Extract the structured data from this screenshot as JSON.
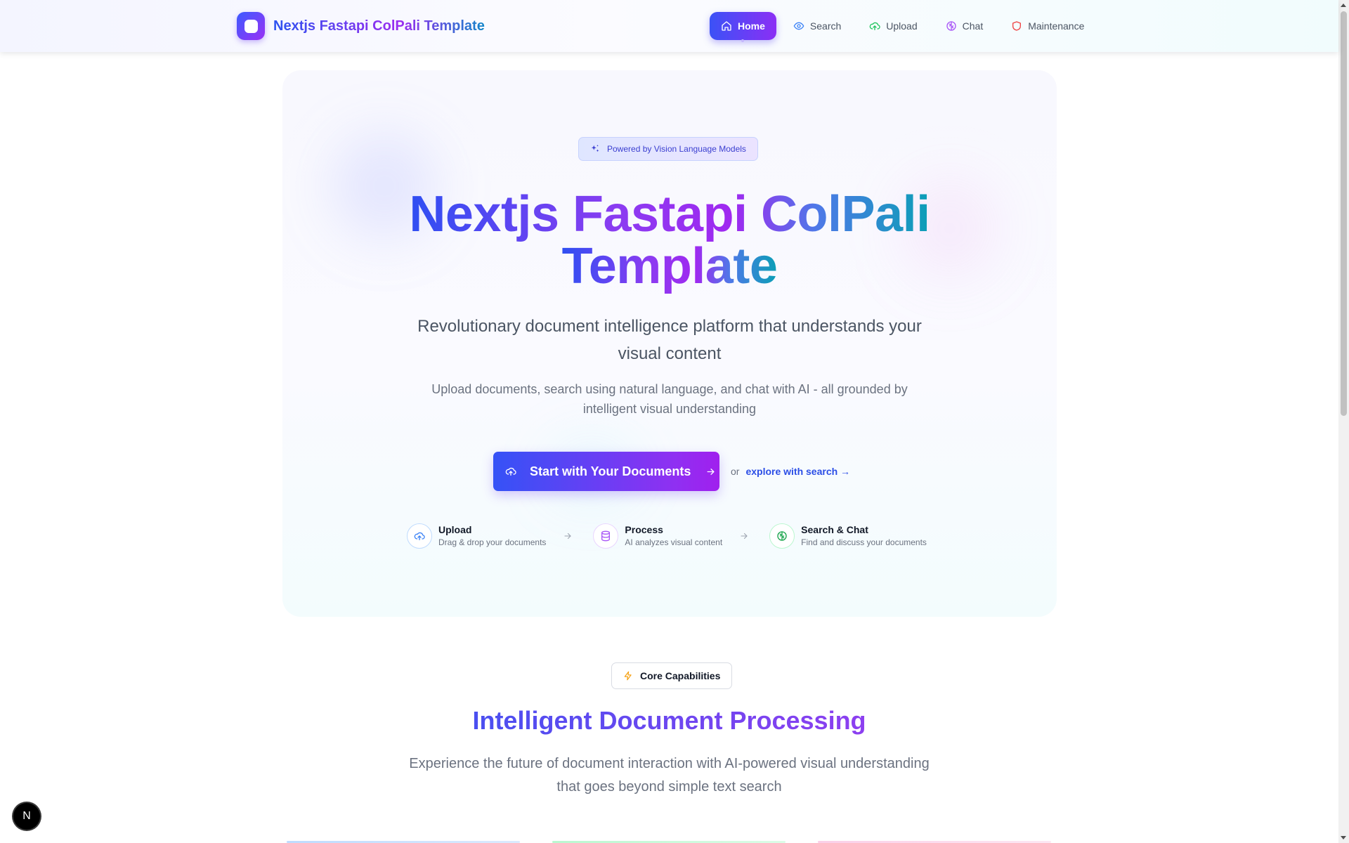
{
  "brand": {
    "name": "Nextjs Fastapi ColPali Template"
  },
  "nav": {
    "items": [
      {
        "label": "Home",
        "icon": "home-icon",
        "active": true
      },
      {
        "label": "Search",
        "icon": "eye-icon",
        "color": "#3b82f6"
      },
      {
        "label": "Upload",
        "icon": "cloud-upload-icon",
        "color": "#22c55e"
      },
      {
        "label": "Chat",
        "icon": "brain-icon",
        "color": "#a855f7"
      },
      {
        "label": "Maintenance",
        "icon": "shield-icon",
        "color": "#ef4444"
      }
    ]
  },
  "hero": {
    "badge": "Powered by Vision Language Models",
    "title_line1": "Nextjs Fastapi ColPali",
    "title_line2": "Template",
    "subtitle": "Revolutionary document intelligence platform that understands your visual content",
    "description": "Upload documents, search using natural language, and chat with AI - all grounded by intelligent visual understanding",
    "cta_label": "Start with Your Documents",
    "or_text": "or",
    "explore_link": "explore with search →",
    "steps": [
      {
        "title": "Upload",
        "desc": "Drag & drop your documents",
        "icon": "upload-icon",
        "color": "#3b82f6"
      },
      {
        "title": "Process",
        "desc": "AI analyzes visual content",
        "icon": "database-icon",
        "color": "#a855f7"
      },
      {
        "title": "Search & Chat",
        "desc": "Find and discuss your documents",
        "icon": "brain-icon",
        "color": "#22c55e"
      }
    ]
  },
  "capabilities": {
    "badge": "Core Capabilities",
    "title": "Intelligent Document Processing",
    "description": "Experience the future of document interaction with AI-powered visual understanding that goes beyond simple text search"
  },
  "nextjs_badge": "N",
  "colors": {
    "accent_blue": "#3552f6",
    "accent_purple": "#9b30f5",
    "accent_teal": "#0b9fb6"
  }
}
